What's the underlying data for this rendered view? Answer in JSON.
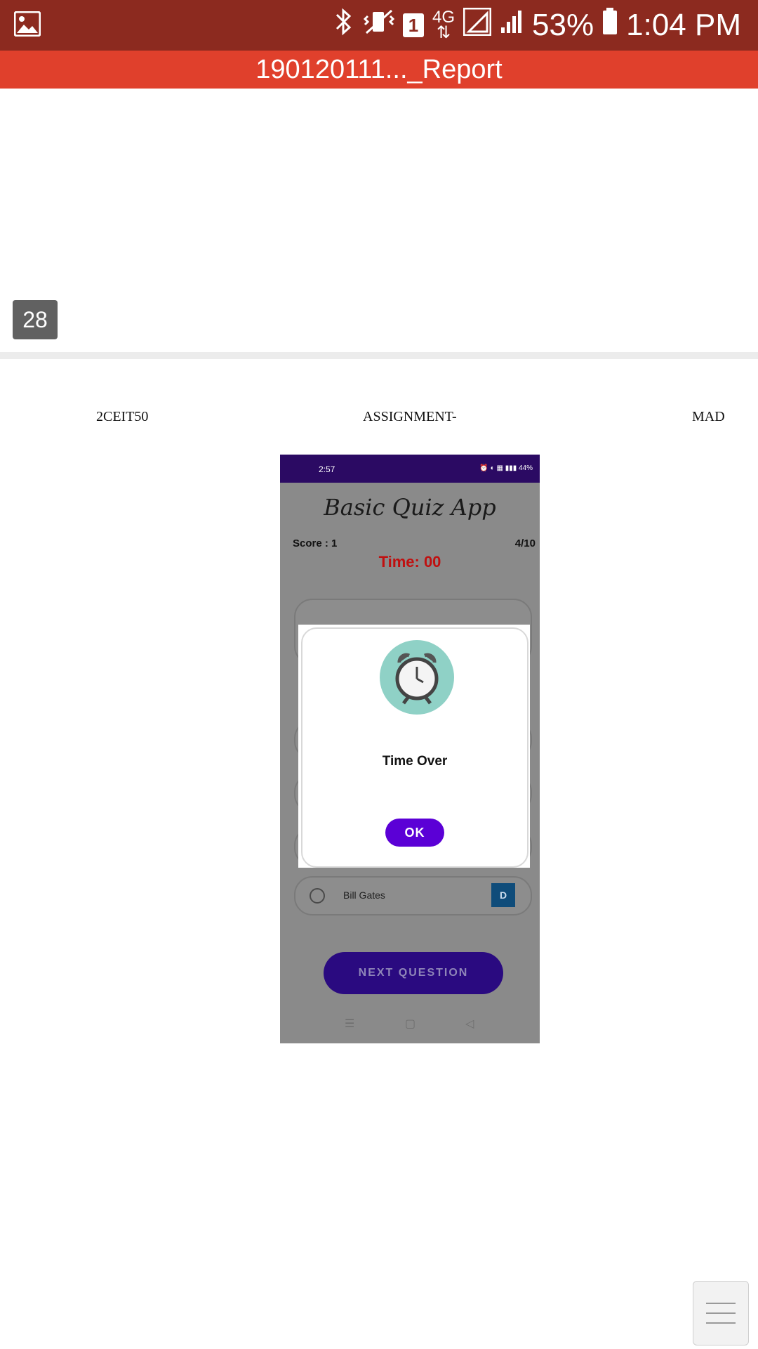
{
  "status_bar": {
    "time": "1:04 PM",
    "battery": "53%",
    "network": "4G",
    "sim": "1",
    "icons": [
      "gallery-icon",
      "bluetooth-icon",
      "vibrate-icon",
      "sim-icon",
      "signal-icon",
      "battery-icon"
    ]
  },
  "title_bar": {
    "title": "190120111..._Report"
  },
  "document": {
    "page_number": "28",
    "header": {
      "left": "2CEIT50",
      "center": "ASSIGNMENT-",
      "right": "MAD"
    },
    "embedded_screenshot": {
      "status_time": "2:57",
      "status_right": "44%",
      "app_title": "Basic Quiz App",
      "score": "Score : 1",
      "progress": "4/10",
      "timer": "Time: 00",
      "last_option": {
        "label": "Bill Gates",
        "letter": "D"
      },
      "next_button": "NEXT QUESTION",
      "dialog": {
        "message": "Time Over",
        "ok_button": "OK"
      }
    }
  },
  "colors": {
    "status_bar": "#8c2a1f",
    "title_bar": "#e0402c",
    "dialog_button": "#5b00d6",
    "timer": "#c01010"
  }
}
